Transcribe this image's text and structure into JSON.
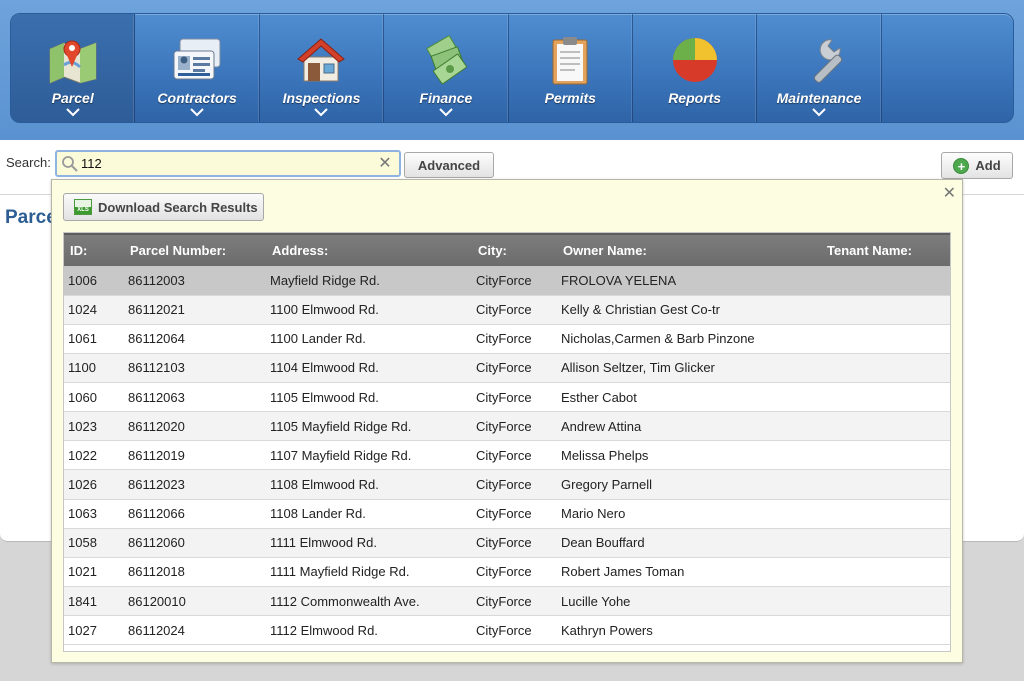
{
  "nav": {
    "items": [
      {
        "label": "Parcel",
        "icon": "map-pin-icon",
        "active": true
      },
      {
        "label": "Contractors",
        "icon": "id-card-icon"
      },
      {
        "label": "Inspections",
        "icon": "house-icon"
      },
      {
        "label": "Finance",
        "icon": "money-icon"
      },
      {
        "label": "Permits",
        "icon": "clipboard-icon"
      },
      {
        "label": "Reports",
        "icon": "pie-chart-icon"
      },
      {
        "label": "Maintenance",
        "icon": "wrench-icon"
      }
    ]
  },
  "search": {
    "label": "Search:",
    "value": "112",
    "advanced_label": "Advanced",
    "add_label": "Add"
  },
  "page": {
    "heading": "Parce"
  },
  "results": {
    "download_label": "Download Search Results",
    "xls_badge": "XLS",
    "columns": [
      "ID:",
      "Parcel Number:",
      "Address:",
      "City:",
      "Owner Name:",
      "Tenant Name:"
    ],
    "rows": [
      [
        "1006",
        "86112003",
        "Mayfield Ridge Rd.",
        "CityForce",
        "FROLOVA YELENA",
        ""
      ],
      [
        "1024",
        "86112021",
        "1100 Elmwood Rd.",
        "CityForce",
        "Kelly & Christian Gest Co-tr",
        ""
      ],
      [
        "1061",
        "86112064",
        "1100 Lander Rd.",
        "CityForce",
        "Nicholas,Carmen & Barb Pinzone",
        ""
      ],
      [
        "1100",
        "86112103",
        "1104 Elmwood Rd.",
        "CityForce",
        "Allison Seltzer, Tim Glicker",
        ""
      ],
      [
        "1060",
        "86112063",
        "1105 Elmwood Rd.",
        "CityForce",
        "Esther Cabot",
        ""
      ],
      [
        "1023",
        "86112020",
        "1105 Mayfield Ridge Rd.",
        "CityForce",
        "Andrew Attina",
        ""
      ],
      [
        "1022",
        "86112019",
        "1107 Mayfield Ridge Rd.",
        "CityForce",
        "Melissa Phelps",
        ""
      ],
      [
        "1026",
        "86112023",
        "1108 Elmwood Rd.",
        "CityForce",
        "Gregory Parnell",
        ""
      ],
      [
        "1063",
        "86112066",
        "1108 Lander Rd.",
        "CityForce",
        "Mario Nero",
        ""
      ],
      [
        "1058",
        "86112060",
        "1111 Elmwood Rd.",
        "CityForce",
        "Dean Bouffard",
        ""
      ],
      [
        "1021",
        "86112018",
        "1111 Mayfield Ridge Rd.",
        "CityForce",
        "Robert James Toman",
        ""
      ],
      [
        "1841",
        "86120010",
        "1112 Commonwealth Ave.",
        "CityForce",
        "Lucille Yohe",
        ""
      ],
      [
        "1027",
        "86112024",
        "1112 Elmwood Rd.",
        "CityForce",
        "Kathryn Powers",
        ""
      ]
    ]
  }
}
